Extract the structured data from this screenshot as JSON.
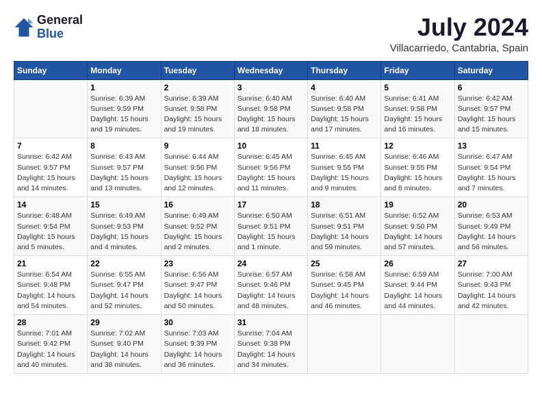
{
  "logo": {
    "text1": "General",
    "text2": "Blue"
  },
  "title": "July 2024",
  "subtitle": "Villacarriedo, Cantabria, Spain",
  "headers": [
    "Sunday",
    "Monday",
    "Tuesday",
    "Wednesday",
    "Thursday",
    "Friday",
    "Saturday"
  ],
  "weeks": [
    [
      {
        "day": "",
        "detail": ""
      },
      {
        "day": "1",
        "detail": "Sunrise: 6:39 AM\nSunset: 9:59 PM\nDaylight: 15 hours\nand 19 minutes."
      },
      {
        "day": "2",
        "detail": "Sunrise: 6:39 AM\nSunset: 9:58 PM\nDaylight: 15 hours\nand 19 minutes."
      },
      {
        "day": "3",
        "detail": "Sunrise: 6:40 AM\nSunset: 9:58 PM\nDaylight: 15 hours\nand 18 minutes."
      },
      {
        "day": "4",
        "detail": "Sunrise: 6:40 AM\nSunset: 9:58 PM\nDaylight: 15 hours\nand 17 minutes."
      },
      {
        "day": "5",
        "detail": "Sunrise: 6:41 AM\nSunset: 9:58 PM\nDaylight: 15 hours\nand 16 minutes."
      },
      {
        "day": "6",
        "detail": "Sunrise: 6:42 AM\nSunset: 9:57 PM\nDaylight: 15 hours\nand 15 minutes."
      }
    ],
    [
      {
        "day": "7",
        "detail": "Sunrise: 6:42 AM\nSunset: 9:57 PM\nDaylight: 15 hours\nand 14 minutes."
      },
      {
        "day": "8",
        "detail": "Sunrise: 6:43 AM\nSunset: 9:57 PM\nDaylight: 15 hours\nand 13 minutes."
      },
      {
        "day": "9",
        "detail": "Sunrise: 6:44 AM\nSunset: 9:56 PM\nDaylight: 15 hours\nand 12 minutes."
      },
      {
        "day": "10",
        "detail": "Sunrise: 6:45 AM\nSunset: 9:56 PM\nDaylight: 15 hours\nand 11 minutes."
      },
      {
        "day": "11",
        "detail": "Sunrise: 6:45 AM\nSunset: 9:55 PM\nDaylight: 15 hours\nand 9 minutes."
      },
      {
        "day": "12",
        "detail": "Sunrise: 6:46 AM\nSunset: 9:55 PM\nDaylight: 15 hours\nand 8 minutes."
      },
      {
        "day": "13",
        "detail": "Sunrise: 6:47 AM\nSunset: 9:54 PM\nDaylight: 15 hours\nand 7 minutes."
      }
    ],
    [
      {
        "day": "14",
        "detail": "Sunrise: 6:48 AM\nSunset: 9:54 PM\nDaylight: 15 hours\nand 5 minutes."
      },
      {
        "day": "15",
        "detail": "Sunrise: 6:49 AM\nSunset: 9:53 PM\nDaylight: 15 hours\nand 4 minutes."
      },
      {
        "day": "16",
        "detail": "Sunrise: 6:49 AM\nSunset: 9:52 PM\nDaylight: 15 hours\nand 2 minutes."
      },
      {
        "day": "17",
        "detail": "Sunrise: 6:50 AM\nSunset: 9:51 PM\nDaylight: 15 hours\nand 1 minute."
      },
      {
        "day": "18",
        "detail": "Sunrise: 6:51 AM\nSunset: 9:51 PM\nDaylight: 14 hours\nand 59 minutes."
      },
      {
        "day": "19",
        "detail": "Sunrise: 6:52 AM\nSunset: 9:50 PM\nDaylight: 14 hours\nand 57 minutes."
      },
      {
        "day": "20",
        "detail": "Sunrise: 6:53 AM\nSunset: 9:49 PM\nDaylight: 14 hours\nand 56 minutes."
      }
    ],
    [
      {
        "day": "21",
        "detail": "Sunrise: 6:54 AM\nSunset: 9:48 PM\nDaylight: 14 hours\nand 54 minutes."
      },
      {
        "day": "22",
        "detail": "Sunrise: 6:55 AM\nSunset: 9:47 PM\nDaylight: 14 hours\nand 52 minutes."
      },
      {
        "day": "23",
        "detail": "Sunrise: 6:56 AM\nSunset: 9:47 PM\nDaylight: 14 hours\nand 50 minutes."
      },
      {
        "day": "24",
        "detail": "Sunrise: 6:57 AM\nSunset: 9:46 PM\nDaylight: 14 hours\nand 48 minutes."
      },
      {
        "day": "25",
        "detail": "Sunrise: 6:58 AM\nSunset: 9:45 PM\nDaylight: 14 hours\nand 46 minutes."
      },
      {
        "day": "26",
        "detail": "Sunrise: 6:59 AM\nSunset: 9:44 PM\nDaylight: 14 hours\nand 44 minutes."
      },
      {
        "day": "27",
        "detail": "Sunrise: 7:00 AM\nSunset: 9:43 PM\nDaylight: 14 hours\nand 42 minutes."
      }
    ],
    [
      {
        "day": "28",
        "detail": "Sunrise: 7:01 AM\nSunset: 9:42 PM\nDaylight: 14 hours\nand 40 minutes."
      },
      {
        "day": "29",
        "detail": "Sunrise: 7:02 AM\nSunset: 9:40 PM\nDaylight: 14 hours\nand 38 minutes."
      },
      {
        "day": "30",
        "detail": "Sunrise: 7:03 AM\nSunset: 9:39 PM\nDaylight: 14 hours\nand 36 minutes."
      },
      {
        "day": "31",
        "detail": "Sunrise: 7:04 AM\nSunset: 9:38 PM\nDaylight: 14 hours\nand 34 minutes."
      },
      {
        "day": "",
        "detail": ""
      },
      {
        "day": "",
        "detail": ""
      },
      {
        "day": "",
        "detail": ""
      }
    ]
  ]
}
